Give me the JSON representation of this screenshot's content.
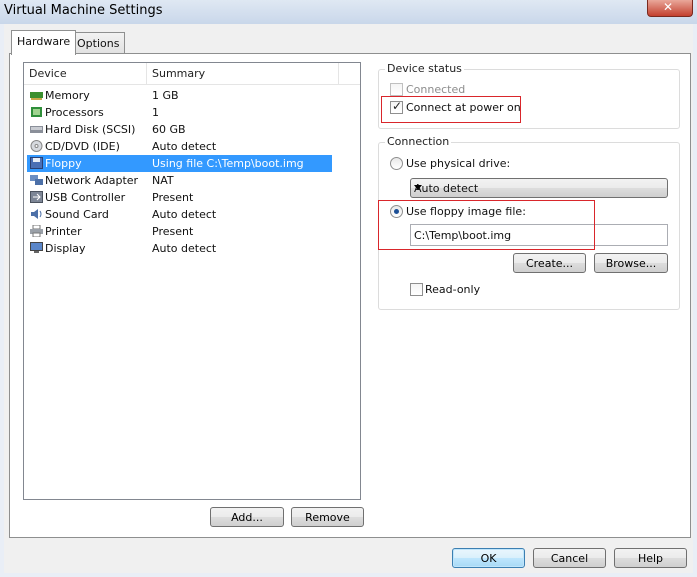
{
  "window": {
    "title": "Virtual Machine Settings"
  },
  "tabs": [
    {
      "label": "Hardware"
    },
    {
      "label": "Options"
    }
  ],
  "device_list": {
    "columns": [
      "Device",
      "Summary"
    ],
    "rows": [
      {
        "icon": "memory-icon",
        "device": "Memory",
        "summary": "1 GB"
      },
      {
        "icon": "processor-icon",
        "device": "Processors",
        "summary": "1"
      },
      {
        "icon": "hard-disk-icon",
        "device": "Hard Disk (SCSI)",
        "summary": "60 GB"
      },
      {
        "icon": "cd-dvd-icon",
        "device": "CD/DVD (IDE)",
        "summary": "Auto detect"
      },
      {
        "icon": "floppy-icon",
        "device": "Floppy",
        "summary": "Using file C:\\Temp\\boot.img",
        "selected": true
      },
      {
        "icon": "network-icon",
        "device": "Network Adapter",
        "summary": "NAT"
      },
      {
        "icon": "usb-icon",
        "device": "USB Controller",
        "summary": "Present"
      },
      {
        "icon": "sound-icon",
        "device": "Sound Card",
        "summary": "Auto detect"
      },
      {
        "icon": "printer-icon",
        "device": "Printer",
        "summary": "Present"
      },
      {
        "icon": "display-icon",
        "device": "Display",
        "summary": "Auto detect"
      }
    ]
  },
  "list_buttons": {
    "add": "Add...",
    "remove": "Remove"
  },
  "device_status": {
    "title": "Device status",
    "connected_label": "Connected",
    "connected_checked": false,
    "connected_enabled": false,
    "connect_power_on_label": "Connect at power on",
    "connect_power_on_checked": true
  },
  "connection": {
    "title": "Connection",
    "physical_label": "Use physical drive:",
    "physical_selected": false,
    "drive_select_value": "Auto detect",
    "image_label": "Use floppy image file:",
    "image_selected": true,
    "image_path": "C:\\Temp\\boot.img",
    "create_label": "Create...",
    "browse_label": "Browse...",
    "readonly_label": "Read-only",
    "readonly_checked": false
  },
  "footer": {
    "ok": "OK",
    "cancel": "Cancel",
    "help": "Help"
  },
  "colors": {
    "selection": "#3399ff",
    "highlight_box": "#d9262b"
  }
}
